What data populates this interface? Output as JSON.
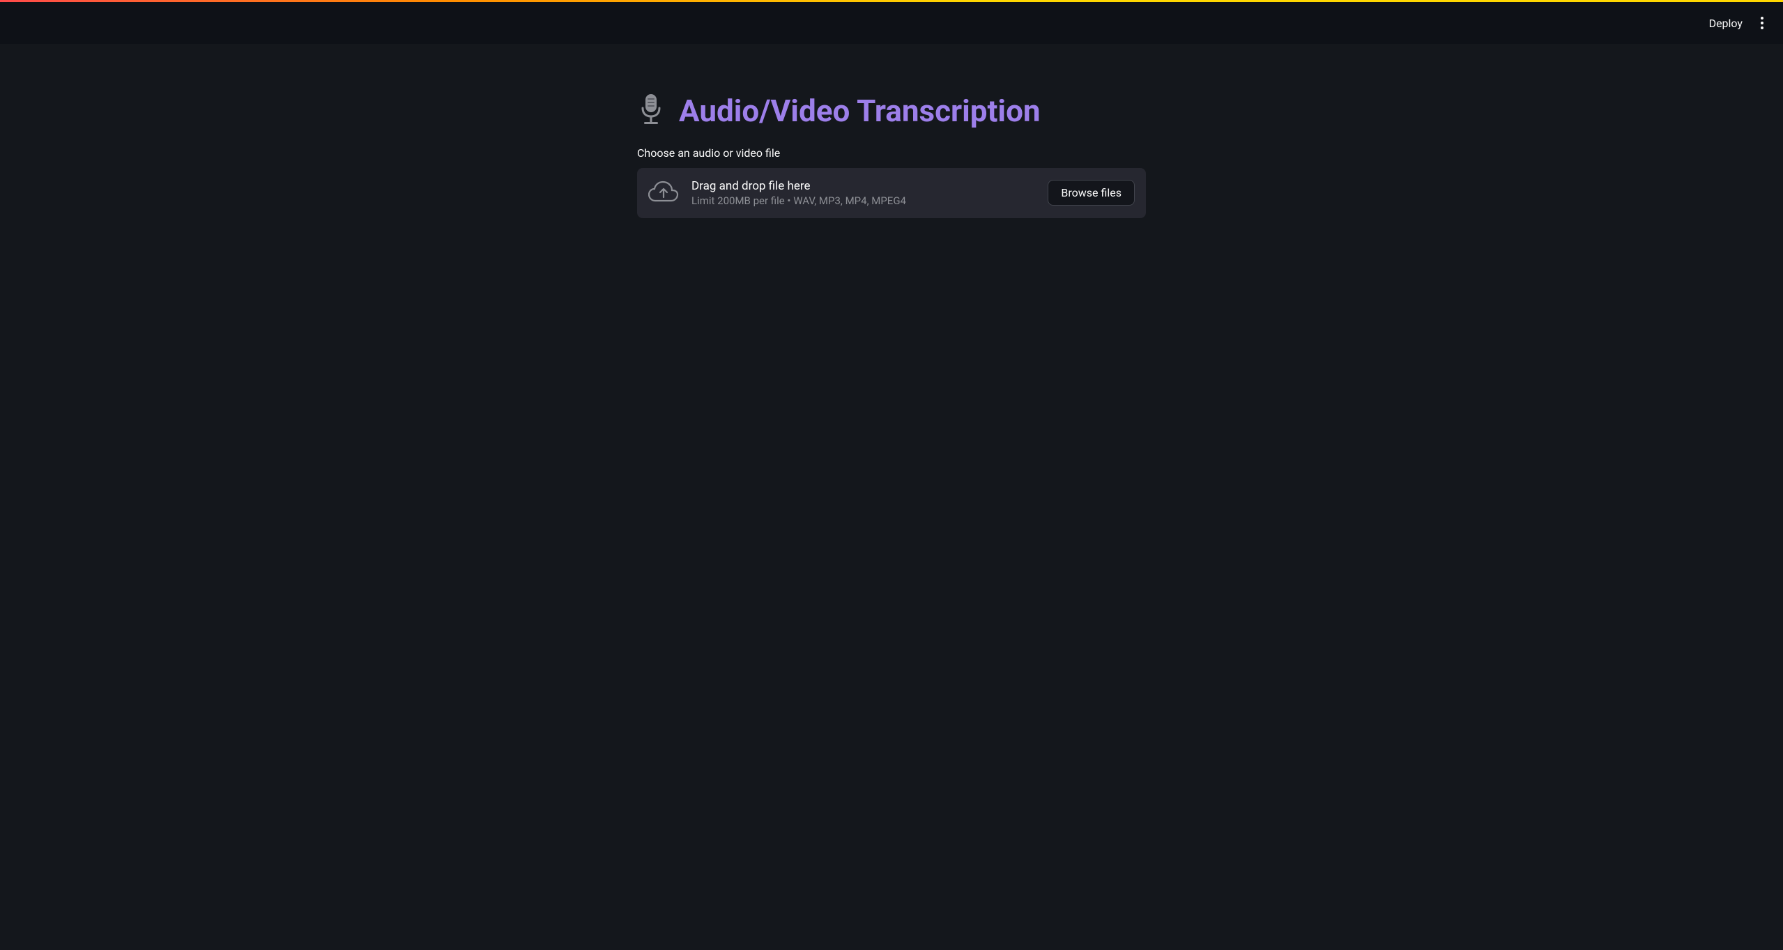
{
  "toolbar": {
    "deploy_label": "Deploy"
  },
  "main": {
    "title": "Audio/Video Transcription",
    "file_label": "Choose an audio or video file",
    "drag_text": "Drag and drop file here",
    "limit_text": "Limit 200MB per file • WAV, MP3, MP4, MPEG4",
    "browse_button": "Browse files"
  },
  "colors": {
    "accent": "#9d7fea",
    "panel": "#262730",
    "bg_main": "#14171c",
    "bg_toolbar": "#0e1117"
  }
}
